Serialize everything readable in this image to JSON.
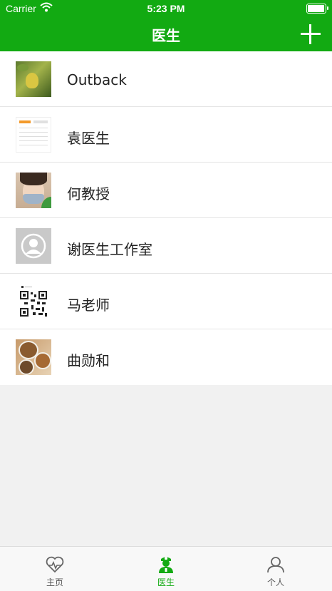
{
  "status_bar": {
    "carrier": "Carrier",
    "time": "5:23 PM"
  },
  "nav": {
    "title": "医生",
    "add_icon": "plus-icon"
  },
  "doctors": [
    {
      "name": "Outback",
      "avatar": "leaf-photo"
    },
    {
      "name": "袁医生",
      "avatar": "document-screenshot"
    },
    {
      "name": "何教授",
      "avatar": "masked-woman-photo"
    },
    {
      "name": "谢医生工作室",
      "avatar": "default-user-avatar"
    },
    {
      "name": "马老师",
      "avatar": "qr-code-image"
    },
    {
      "name": "曲勋和",
      "avatar": "food-bowls-photo"
    }
  ],
  "tabs": [
    {
      "label": "主页",
      "icon": "heart-pulse-icon",
      "active": false
    },
    {
      "label": "医生",
      "icon": "doctor-icon",
      "active": true
    },
    {
      "label": "个人",
      "icon": "person-icon",
      "active": false
    }
  ],
  "colors": {
    "primary": "#12aa12",
    "background": "#f1f1f1"
  }
}
